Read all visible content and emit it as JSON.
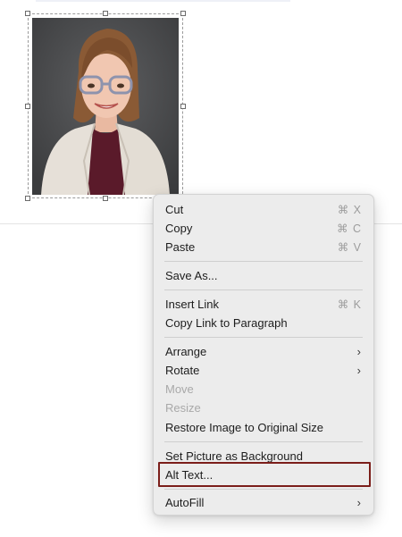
{
  "menu": {
    "items": [
      {
        "label": "Cut",
        "shortcut": "⌘ X"
      },
      {
        "label": "Copy",
        "shortcut": "⌘ C"
      },
      {
        "label": "Paste",
        "shortcut": "⌘ V"
      },
      {
        "label": "Save As..."
      },
      {
        "label": "Insert Link",
        "shortcut": "⌘ K"
      },
      {
        "label": "Copy Link to Paragraph"
      },
      {
        "label": "Arrange",
        "submenu": true
      },
      {
        "label": "Rotate",
        "submenu": true
      },
      {
        "label": "Move",
        "disabled": true
      },
      {
        "label": "Resize",
        "disabled": true
      },
      {
        "label": "Restore Image to Original Size"
      },
      {
        "label": "Set Picture as Background"
      },
      {
        "label": "Alt Text...",
        "highlighted": true
      },
      {
        "label": "AutoFill",
        "submenu": true
      }
    ],
    "submenu_arrow": "›"
  },
  "colors": {
    "highlight_border": "#7b1e1a",
    "menu_background": "#ececec"
  },
  "picture": {
    "icon": "portrait-photo"
  }
}
